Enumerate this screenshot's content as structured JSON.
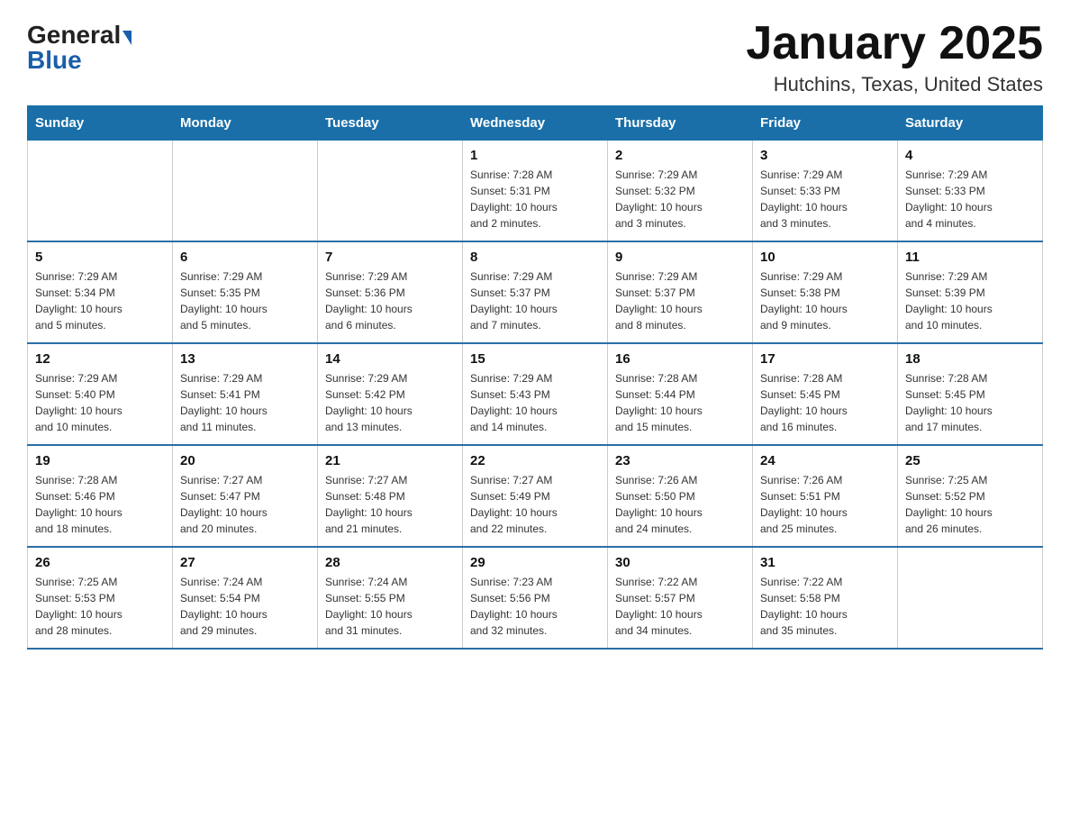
{
  "logo": {
    "general": "General",
    "blue": "Blue"
  },
  "title": "January 2025",
  "subtitle": "Hutchins, Texas, United States",
  "header_days": [
    "Sunday",
    "Monday",
    "Tuesday",
    "Wednesday",
    "Thursday",
    "Friday",
    "Saturday"
  ],
  "weeks": [
    [
      {
        "num": "",
        "info": ""
      },
      {
        "num": "",
        "info": ""
      },
      {
        "num": "",
        "info": ""
      },
      {
        "num": "1",
        "info": "Sunrise: 7:28 AM\nSunset: 5:31 PM\nDaylight: 10 hours\nand 2 minutes."
      },
      {
        "num": "2",
        "info": "Sunrise: 7:29 AM\nSunset: 5:32 PM\nDaylight: 10 hours\nand 3 minutes."
      },
      {
        "num": "3",
        "info": "Sunrise: 7:29 AM\nSunset: 5:33 PM\nDaylight: 10 hours\nand 3 minutes."
      },
      {
        "num": "4",
        "info": "Sunrise: 7:29 AM\nSunset: 5:33 PM\nDaylight: 10 hours\nand 4 minutes."
      }
    ],
    [
      {
        "num": "5",
        "info": "Sunrise: 7:29 AM\nSunset: 5:34 PM\nDaylight: 10 hours\nand 5 minutes."
      },
      {
        "num": "6",
        "info": "Sunrise: 7:29 AM\nSunset: 5:35 PM\nDaylight: 10 hours\nand 5 minutes."
      },
      {
        "num": "7",
        "info": "Sunrise: 7:29 AM\nSunset: 5:36 PM\nDaylight: 10 hours\nand 6 minutes."
      },
      {
        "num": "8",
        "info": "Sunrise: 7:29 AM\nSunset: 5:37 PM\nDaylight: 10 hours\nand 7 minutes."
      },
      {
        "num": "9",
        "info": "Sunrise: 7:29 AM\nSunset: 5:37 PM\nDaylight: 10 hours\nand 8 minutes."
      },
      {
        "num": "10",
        "info": "Sunrise: 7:29 AM\nSunset: 5:38 PM\nDaylight: 10 hours\nand 9 minutes."
      },
      {
        "num": "11",
        "info": "Sunrise: 7:29 AM\nSunset: 5:39 PM\nDaylight: 10 hours\nand 10 minutes."
      }
    ],
    [
      {
        "num": "12",
        "info": "Sunrise: 7:29 AM\nSunset: 5:40 PM\nDaylight: 10 hours\nand 10 minutes."
      },
      {
        "num": "13",
        "info": "Sunrise: 7:29 AM\nSunset: 5:41 PM\nDaylight: 10 hours\nand 11 minutes."
      },
      {
        "num": "14",
        "info": "Sunrise: 7:29 AM\nSunset: 5:42 PM\nDaylight: 10 hours\nand 13 minutes."
      },
      {
        "num": "15",
        "info": "Sunrise: 7:29 AM\nSunset: 5:43 PM\nDaylight: 10 hours\nand 14 minutes."
      },
      {
        "num": "16",
        "info": "Sunrise: 7:28 AM\nSunset: 5:44 PM\nDaylight: 10 hours\nand 15 minutes."
      },
      {
        "num": "17",
        "info": "Sunrise: 7:28 AM\nSunset: 5:45 PM\nDaylight: 10 hours\nand 16 minutes."
      },
      {
        "num": "18",
        "info": "Sunrise: 7:28 AM\nSunset: 5:45 PM\nDaylight: 10 hours\nand 17 minutes."
      }
    ],
    [
      {
        "num": "19",
        "info": "Sunrise: 7:28 AM\nSunset: 5:46 PM\nDaylight: 10 hours\nand 18 minutes."
      },
      {
        "num": "20",
        "info": "Sunrise: 7:27 AM\nSunset: 5:47 PM\nDaylight: 10 hours\nand 20 minutes."
      },
      {
        "num": "21",
        "info": "Sunrise: 7:27 AM\nSunset: 5:48 PM\nDaylight: 10 hours\nand 21 minutes."
      },
      {
        "num": "22",
        "info": "Sunrise: 7:27 AM\nSunset: 5:49 PM\nDaylight: 10 hours\nand 22 minutes."
      },
      {
        "num": "23",
        "info": "Sunrise: 7:26 AM\nSunset: 5:50 PM\nDaylight: 10 hours\nand 24 minutes."
      },
      {
        "num": "24",
        "info": "Sunrise: 7:26 AM\nSunset: 5:51 PM\nDaylight: 10 hours\nand 25 minutes."
      },
      {
        "num": "25",
        "info": "Sunrise: 7:25 AM\nSunset: 5:52 PM\nDaylight: 10 hours\nand 26 minutes."
      }
    ],
    [
      {
        "num": "26",
        "info": "Sunrise: 7:25 AM\nSunset: 5:53 PM\nDaylight: 10 hours\nand 28 minutes."
      },
      {
        "num": "27",
        "info": "Sunrise: 7:24 AM\nSunset: 5:54 PM\nDaylight: 10 hours\nand 29 minutes."
      },
      {
        "num": "28",
        "info": "Sunrise: 7:24 AM\nSunset: 5:55 PM\nDaylight: 10 hours\nand 31 minutes."
      },
      {
        "num": "29",
        "info": "Sunrise: 7:23 AM\nSunset: 5:56 PM\nDaylight: 10 hours\nand 32 minutes."
      },
      {
        "num": "30",
        "info": "Sunrise: 7:22 AM\nSunset: 5:57 PM\nDaylight: 10 hours\nand 34 minutes."
      },
      {
        "num": "31",
        "info": "Sunrise: 7:22 AM\nSunset: 5:58 PM\nDaylight: 10 hours\nand 35 minutes."
      },
      {
        "num": "",
        "info": ""
      }
    ]
  ]
}
